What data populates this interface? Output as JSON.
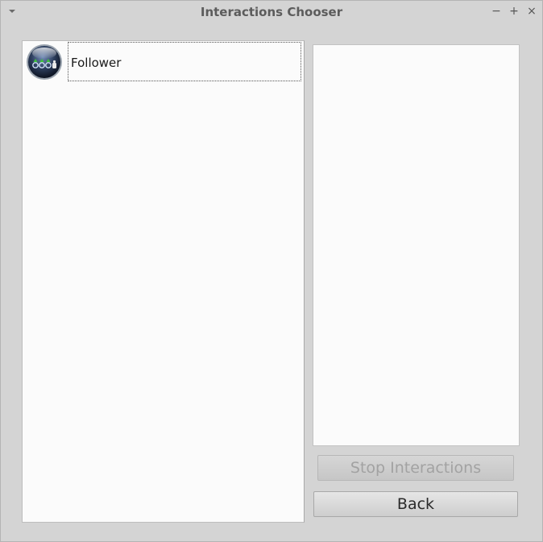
{
  "window": {
    "title": "Interactions Chooser",
    "controls": {
      "minimize": "−",
      "maximize": "+",
      "close": "×"
    }
  },
  "interactions_list": {
    "items": [
      {
        "label": "Follower",
        "icon": "robot-follower-icon",
        "selected": true
      }
    ]
  },
  "detail_panel": {
    "content": ""
  },
  "buttons": {
    "stop_interactions": {
      "label": "Stop Interactions",
      "enabled": false
    },
    "back": {
      "label": "Back",
      "enabled": true
    }
  },
  "colors": {
    "window_bg": "#d4d4d4",
    "panel_bg": "#fbfbfb",
    "title_text": "#5c5c5c",
    "disabled_text": "#a2a2a2"
  }
}
